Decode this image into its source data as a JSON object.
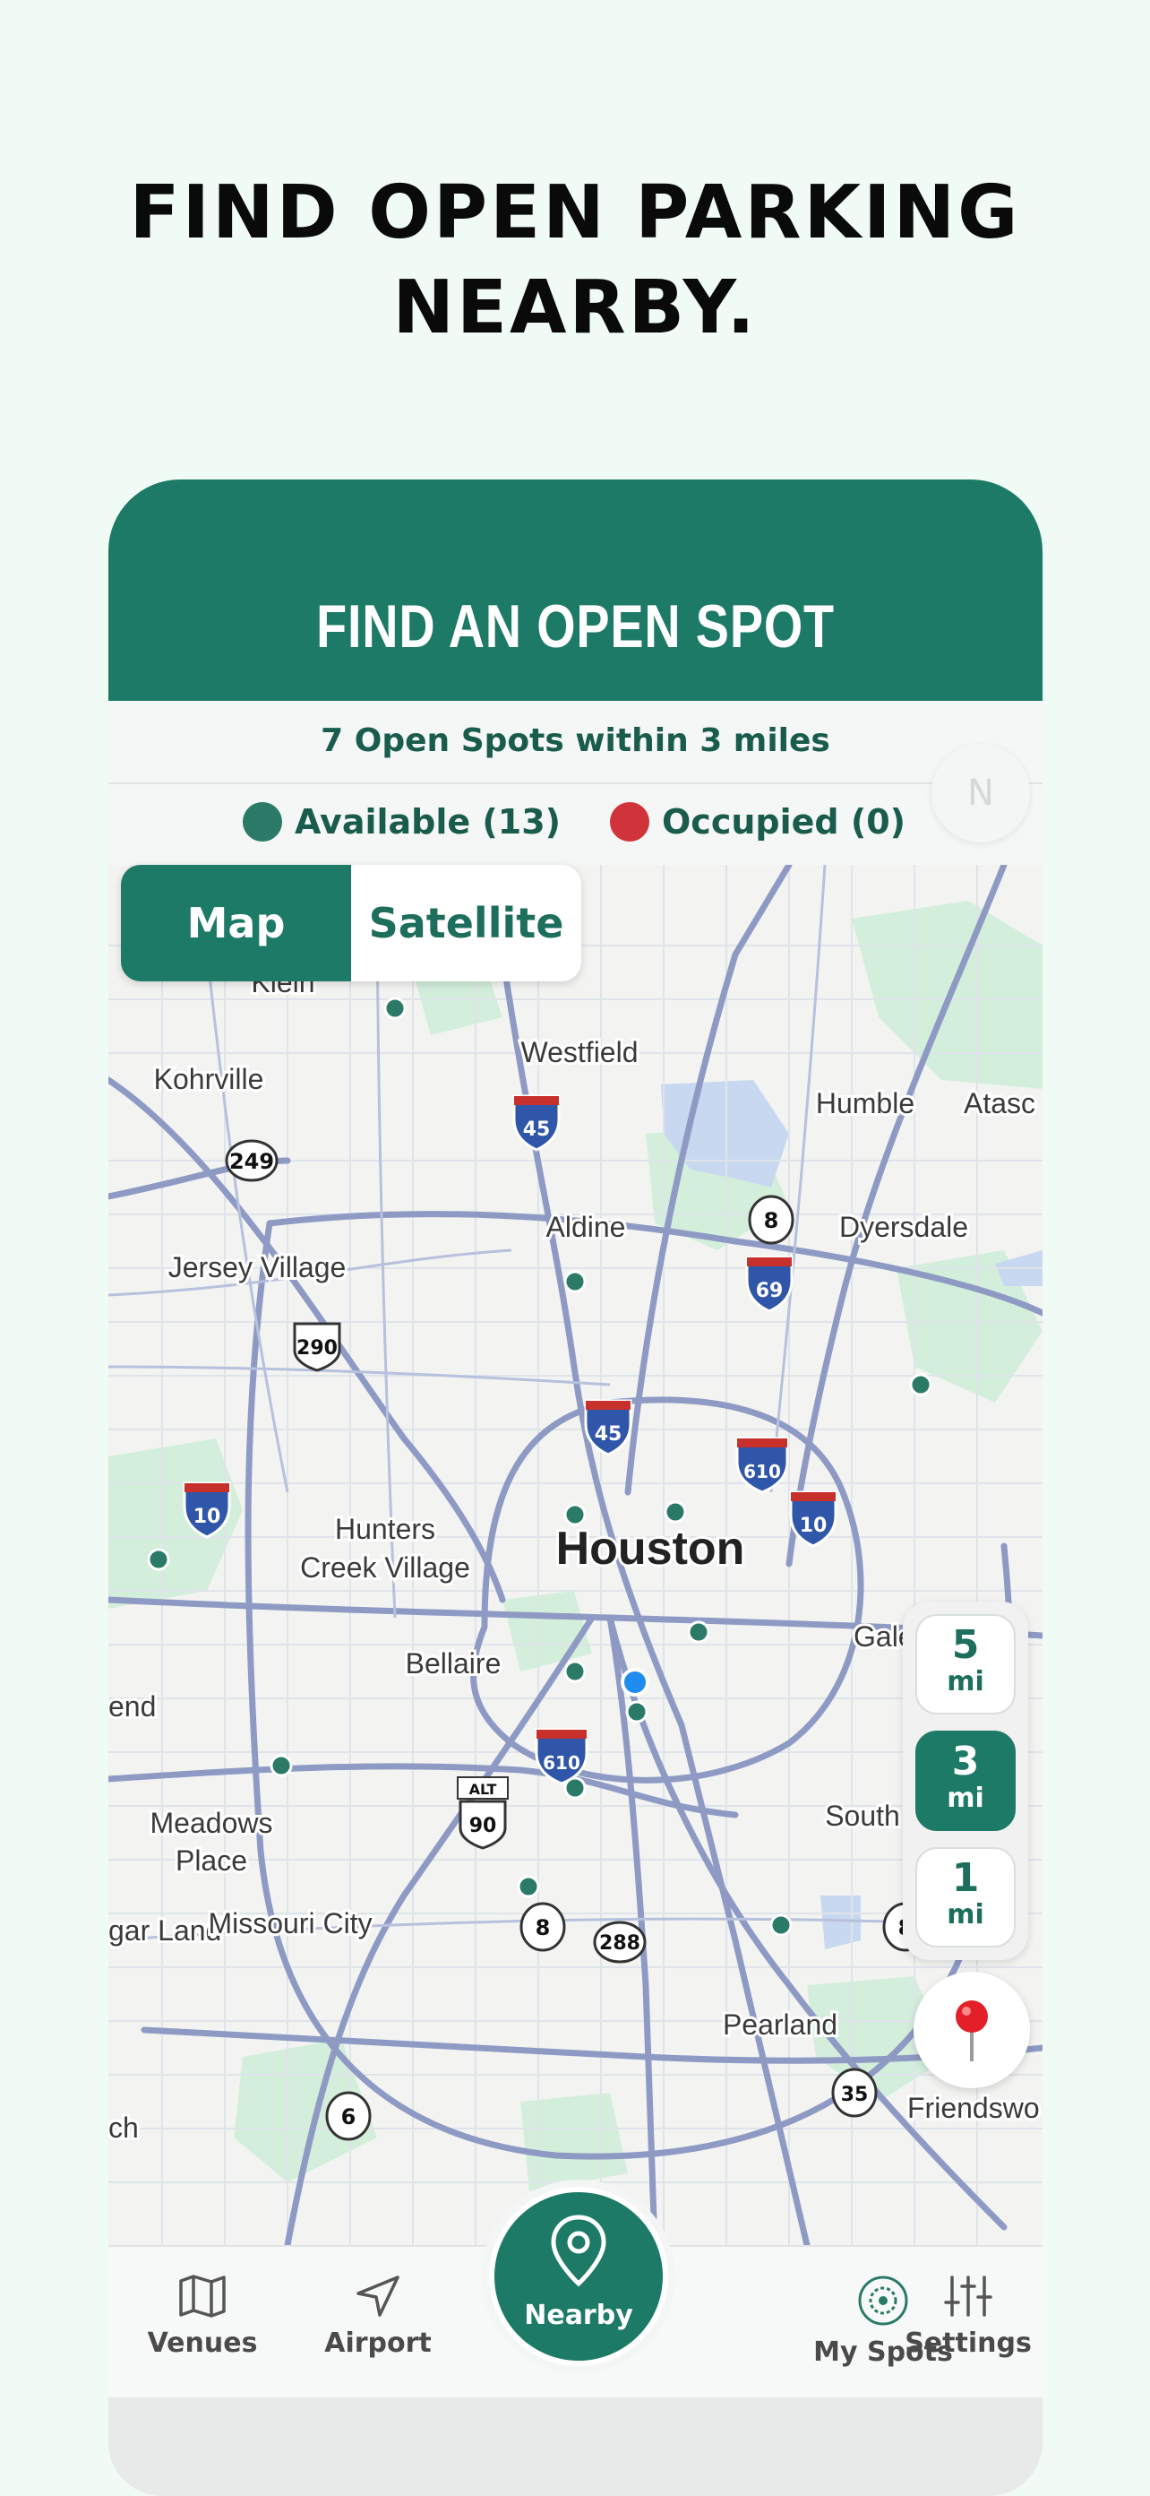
{
  "headline": {
    "line1": "FIND OPEN PARKING",
    "line2": "NEARBY."
  },
  "header": {
    "title": "FIND AN OPEN SPOT"
  },
  "summary": {
    "text": "7 Open Spots within 3 miles"
  },
  "legend": {
    "available": "Available (13)",
    "occupied": "Occupied (0)",
    "available_color": "#2a7a67",
    "occupied_color": "#d0343a"
  },
  "compass_label": "N",
  "map_toggle": {
    "map": "Map",
    "satellite": "Satellite",
    "selected": "Map"
  },
  "map_labels": {
    "places": [
      "Klein",
      "Kohrville",
      "Westfield",
      "Humble",
      "Atasc",
      "Aldine",
      "Dyersdale",
      "Jersey Village",
      "Hunters",
      "Creek Village",
      "Houston",
      "Gale",
      "Bellaire",
      "end",
      "Meadows",
      "Place",
      "South",
      "gar Land",
      "Missouri City",
      "Pearland",
      "Friendswo",
      "ch"
    ],
    "highway_shields": [
      "45",
      "249",
      "8",
      "69",
      "290",
      "45",
      "610",
      "10",
      "10",
      "610",
      "ALT",
      "90",
      "8",
      "288",
      "8",
      "6",
      "35"
    ]
  },
  "radius": {
    "options": [
      {
        "num": "5",
        "unit": "mi"
      },
      {
        "num": "3",
        "unit": "mi"
      },
      {
        "num": "1",
        "unit": "mi"
      }
    ],
    "selected": "3"
  },
  "nav": {
    "venues": "Venues",
    "airport": "Airport",
    "nearby": "Nearby",
    "my_spots": "My Spots",
    "settings": "Settings"
  },
  "colors": {
    "brand": "#1d7a67",
    "background": "#f1fbf6",
    "user_location": "#1f8cf0"
  }
}
